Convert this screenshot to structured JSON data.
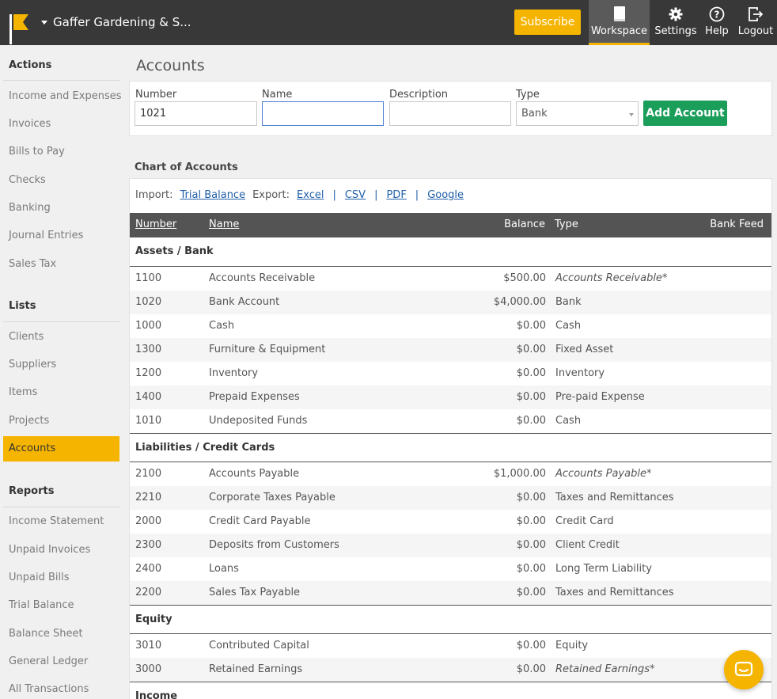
{
  "header": {
    "company": "Gaffer Gardening & S...",
    "subscribe_label": "Subscribe",
    "nav": [
      {
        "label": "Workspace",
        "icon": "document-icon",
        "active": true
      },
      {
        "label": "Settings",
        "icon": "gear-icon"
      },
      {
        "label": "Help",
        "icon": "help-icon"
      },
      {
        "label": "Logout",
        "icon": "logout-icon"
      }
    ],
    "accent_color": "#f5b400"
  },
  "sidebar": {
    "actions_heading": "Actions",
    "actions": [
      "Income and Expenses",
      "Invoices",
      "Bills to Pay",
      "Checks",
      "Banking",
      "Journal Entries",
      "Sales Tax"
    ],
    "lists_heading": "Lists",
    "lists": [
      "Clients",
      "Suppliers",
      "Items",
      "Projects",
      "Accounts"
    ],
    "reports_heading": "Reports",
    "reports": [
      "Income Statement",
      "Unpaid Invoices",
      "Unpaid Bills",
      "Trial Balance",
      "Balance Sheet",
      "General Ledger",
      "All Transactions"
    ]
  },
  "page": {
    "title": "Accounts",
    "form": {
      "number_label": "Number",
      "number_value": "1021",
      "name_label": "Name",
      "name_value": "",
      "description_label": "Description",
      "description_value": "",
      "type_label": "Type",
      "type_value": "Bank",
      "add_button": "Add Account"
    },
    "chart_title": "Chart of Accounts",
    "import_label": "Import:",
    "import_link": "Trial Balance",
    "export_label": "Export:",
    "export_links": [
      "Excel",
      "CSV",
      "PDF",
      "Google"
    ],
    "columns": {
      "number": "Number",
      "name": "Name",
      "balance": "Balance",
      "type": "Type",
      "bank_feed": "Bank Feed"
    },
    "groups": [
      {
        "title": "Assets / Bank",
        "rows": [
          {
            "number": "1100",
            "name": "Accounts Receivable",
            "balance": "$500.00",
            "type": "Accounts Receivable*"
          },
          {
            "number": "1020",
            "name": "Bank Account",
            "balance": "$4,000.00",
            "type": "Bank"
          },
          {
            "number": "1000",
            "name": "Cash",
            "balance": "$0.00",
            "type": "Cash"
          },
          {
            "number": "1300",
            "name": "Furniture & Equipment",
            "balance": "$0.00",
            "type": "Fixed Asset"
          },
          {
            "number": "1200",
            "name": "Inventory",
            "balance": "$0.00",
            "type": "Inventory"
          },
          {
            "number": "1400",
            "name": "Prepaid Expenses",
            "balance": "$0.00",
            "type": "Pre-paid Expense"
          },
          {
            "number": "1010",
            "name": "Undeposited Funds",
            "balance": "$0.00",
            "type": "Cash"
          }
        ]
      },
      {
        "title": "Liabilities / Credit Cards",
        "rows": [
          {
            "number": "2100",
            "name": "Accounts Payable",
            "balance": "$1,000.00",
            "type": "Accounts Payable*"
          },
          {
            "number": "2210",
            "name": "Corporate Taxes Payable",
            "balance": "$0.00",
            "type": "Taxes and Remittances"
          },
          {
            "number": "2000",
            "name": "Credit Card Payable",
            "balance": "$0.00",
            "type": "Credit Card"
          },
          {
            "number": "2300",
            "name": "Deposits from Customers",
            "balance": "$0.00",
            "type": "Client Credit"
          },
          {
            "number": "2400",
            "name": "Loans",
            "balance": "$0.00",
            "type": "Long Term Liability"
          },
          {
            "number": "2200",
            "name": "Sales Tax Payable",
            "balance": "$0.00",
            "type": "Taxes and Remittances"
          }
        ]
      },
      {
        "title": "Equity",
        "rows": [
          {
            "number": "3010",
            "name": "Contributed Capital",
            "balance": "$0.00",
            "type": "Equity"
          },
          {
            "number": "3000",
            "name": "Retained Earnings",
            "balance": "$0.00",
            "type": "Retained Earnings*"
          }
        ]
      },
      {
        "title": "Income",
        "rows": []
      }
    ]
  }
}
